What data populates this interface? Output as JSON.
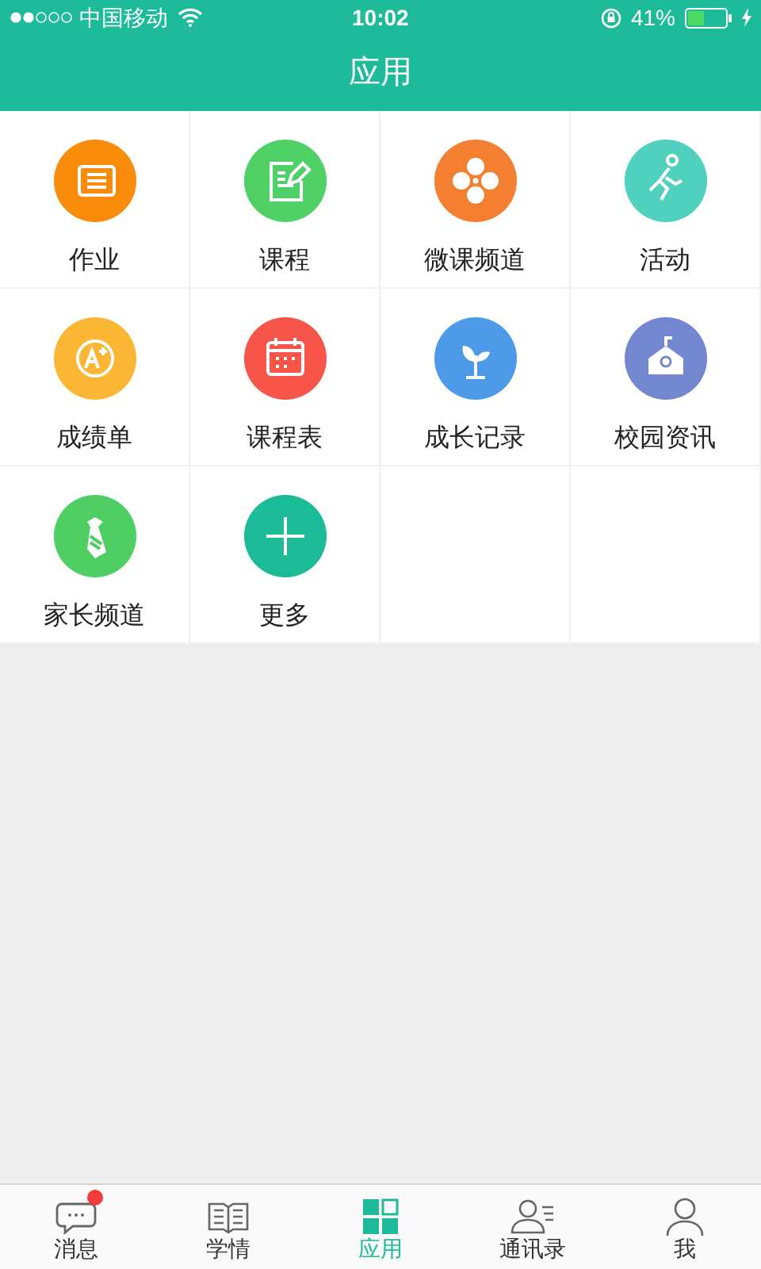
{
  "status_bar": {
    "carrier": "中国移动",
    "time": "10:02",
    "battery": "41%"
  },
  "nav_bar": {
    "title": "应用"
  },
  "apps": [
    {
      "label": "作业",
      "color": "#f98c0b"
    },
    {
      "label": "课程",
      "color": "#4fd065"
    },
    {
      "label": "微课频道",
      "color": "#f57f31"
    },
    {
      "label": "活动",
      "color": "#4fd1be"
    },
    {
      "label": "成绩单",
      "color": "#fbb733"
    },
    {
      "label": "课程表",
      "color": "#f8554a"
    },
    {
      "label": "成长记录",
      "color": "#4d9be8"
    },
    {
      "label": "校园资讯",
      "color": "#7387d0"
    },
    {
      "label": "家长频道",
      "color": "#4fcf63"
    },
    {
      "label": "更多",
      "color": "#1bbb98"
    }
  ],
  "tab_bar": [
    {
      "label": "消息",
      "selected": false,
      "badge": true
    },
    {
      "label": "学情",
      "selected": false,
      "badge": false
    },
    {
      "label": "应用",
      "selected": true,
      "badge": false
    },
    {
      "label": "通讯录",
      "selected": false,
      "badge": false
    },
    {
      "label": "我",
      "selected": false,
      "badge": false
    }
  ]
}
